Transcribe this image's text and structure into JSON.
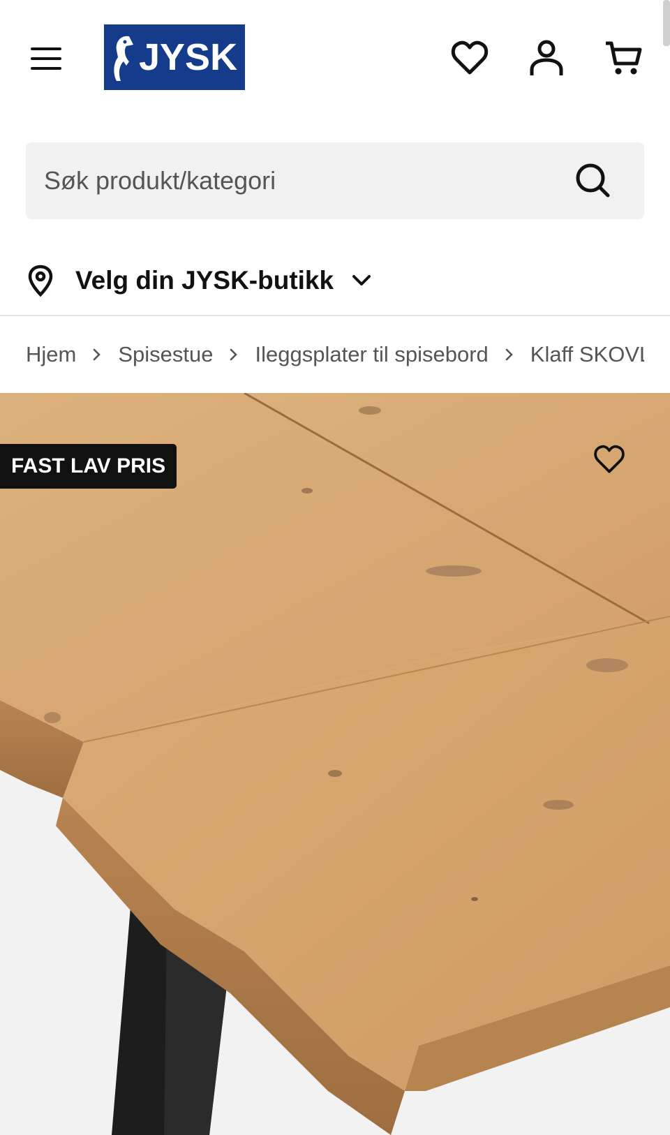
{
  "header": {
    "logo_text": "JYSK",
    "brand_color": "#143c8a",
    "icons": [
      "menu-icon",
      "heart-icon",
      "user-icon",
      "cart-icon"
    ]
  },
  "search": {
    "placeholder": "Søk produkt/kategori",
    "value": ""
  },
  "store_selector": {
    "label": "Velg din JYSK-butikk"
  },
  "breadcrumb": {
    "items": [
      "Hjem",
      "Spisestue",
      "Ileggsplater til spisebord",
      "Klaff SKOVLUND"
    ]
  },
  "product": {
    "badge": "FAST LAV PRIS",
    "badge_color": "#111111"
  }
}
